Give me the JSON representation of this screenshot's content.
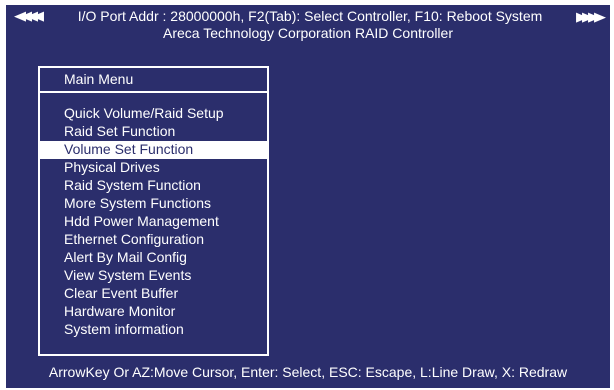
{
  "header": {
    "line1": "I/O Port Addr : 28000000h, F2(Tab): Select Controller, F10: Reboot System",
    "line2": "Areca Technology Corporation RAID Controller",
    "left_arrows": "◀◀◀◀",
    "right_arrows": "▶▶▶▶"
  },
  "menu": {
    "title": "Main Menu",
    "items": [
      {
        "label": "Quick Volume/Raid Setup"
      },
      {
        "label": "Raid Set Function"
      },
      {
        "label": "Volume Set Function"
      },
      {
        "label": "Physical Drives"
      },
      {
        "label": "Raid System Function"
      },
      {
        "label": "More System Functions"
      },
      {
        "label": "Hdd Power Management"
      },
      {
        "label": "Ethernet Configuration"
      },
      {
        "label": "Alert By Mail Config"
      },
      {
        "label": "View System Events"
      },
      {
        "label": "Clear Event Buffer"
      },
      {
        "label": "Hardware Monitor"
      },
      {
        "label": "System information"
      }
    ],
    "selected_label": "Volume Set Function"
  },
  "footer": {
    "help": "ArrowKey Or AZ:Move Cursor, Enter: Select, ESC: Escape, L:Line Draw, X: Redraw"
  },
  "colors": {
    "background": "#2b2e6c",
    "text": "#ffffff",
    "highlight": "#ffffff"
  }
}
